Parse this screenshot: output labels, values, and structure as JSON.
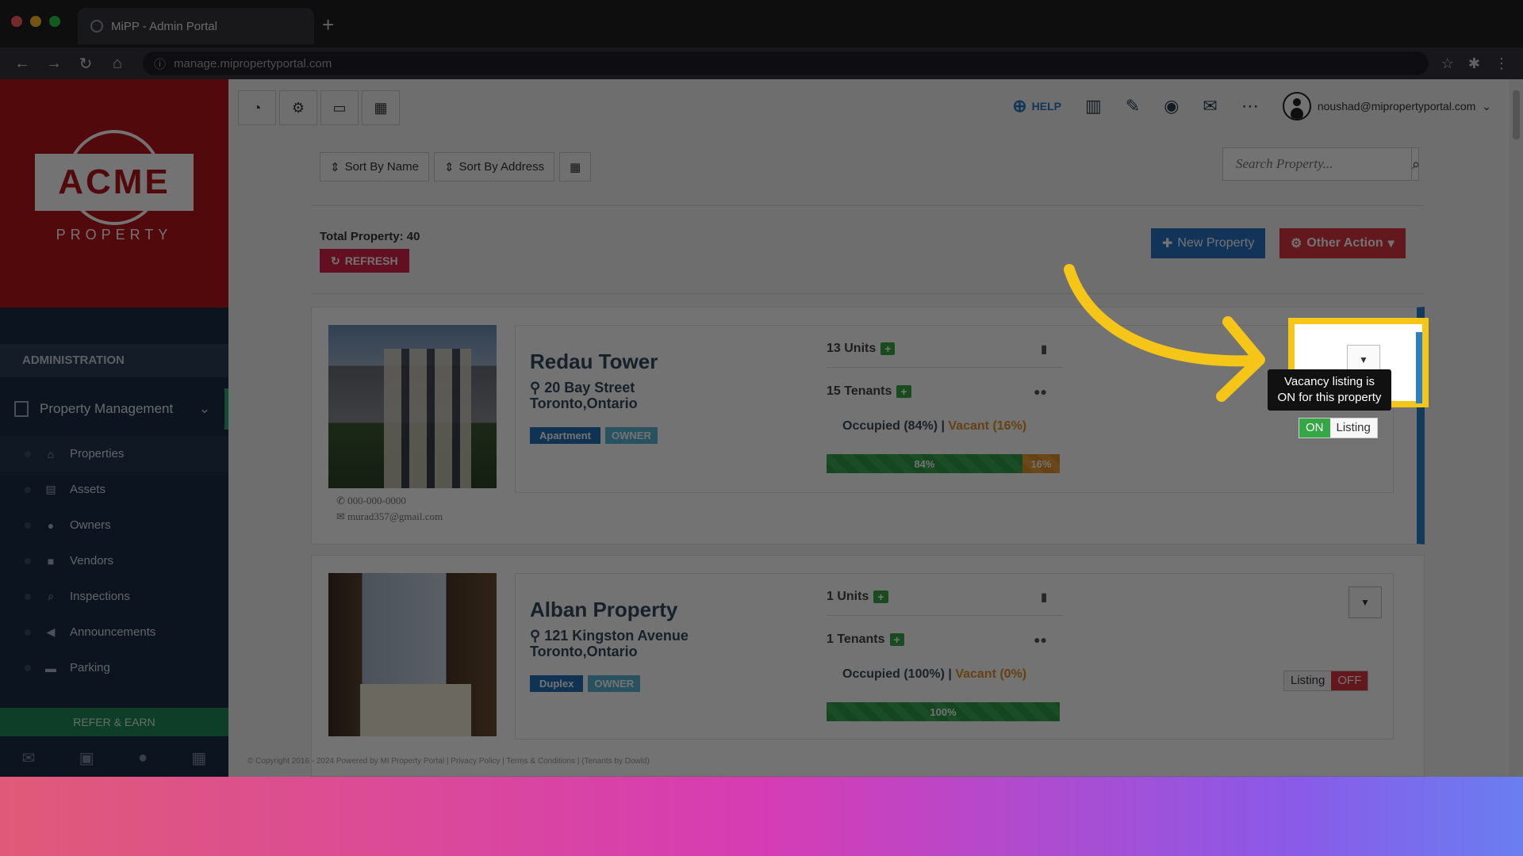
{
  "browser": {
    "tab_title": "MiPP - Admin Portal",
    "url": "manage.mipropertyportal.com"
  },
  "sidebar": {
    "logo_main": "ACME",
    "logo_sub": "PROPERTY",
    "section": "ADMINISTRATION",
    "group": "Property Management",
    "items": [
      {
        "label": "Properties",
        "icon": "home-icon"
      },
      {
        "label": "Assets",
        "icon": "archive-icon"
      },
      {
        "label": "Owners",
        "icon": "user-icon"
      },
      {
        "label": "Vendors",
        "icon": "briefcase-icon"
      },
      {
        "label": "Inspections",
        "icon": "search-icon"
      },
      {
        "label": "Announcements",
        "icon": "megaphone-icon"
      },
      {
        "label": "Parking",
        "icon": "car-icon"
      }
    ],
    "refer": "REFER & EARN"
  },
  "topbar": {
    "help": "HELP",
    "user_email": "noushad@mipropertyportal.com"
  },
  "toolbar": {
    "sort_name": "Sort By Name",
    "sort_address": "Sort By Address",
    "search_placeholder": "Search Property...",
    "total": "Total Property: 40",
    "refresh": "REFRESH",
    "new_property": "New Property",
    "other_action": "Other Action"
  },
  "properties": [
    {
      "name": "Redau Tower",
      "address1": "20 Bay Street",
      "address2": "Toronto,Ontario",
      "type": "Apartment",
      "owner": "OWNER",
      "units": "13 Units",
      "tenants": "15 Tenants",
      "occupied": "Occupied (84%)",
      "vacant": "Vacant (16%)",
      "occupied_pct": 84,
      "vacant_pct": 16,
      "occ_label": "84%",
      "vac_label": "16%",
      "phone": "000-000-0000",
      "email": "murad357@gmail.com",
      "toggle_on": "ON",
      "toggle_label": "Listing"
    },
    {
      "name": "Alban Property",
      "address1": "121 Kingston Avenue",
      "address2": "Toronto,Ontario",
      "type": "Duplex",
      "owner": "OWNER",
      "units": "1 Units",
      "tenants": "1 Tenants",
      "occupied": "Occupied (100%)",
      "vacant": "Vacant (0%)",
      "occupied_pct": 100,
      "vacant_pct": 0,
      "occ_label": "100%",
      "toggle_label": "Listing",
      "toggle_off": "OFF"
    }
  ],
  "tooltip": {
    "text": "Vacancy listing is ON for this property"
  },
  "footer": "© Copyright 2016 - 2024 Powered by MI Property Portal | Privacy Policy | Terms & Conditions | (Tenants by Dowld)",
  "colors": {
    "brand_red": "#b4161b",
    "sidebar": "#1c2f45",
    "highlight": "#f5c518",
    "primary": "#2873c4"
  }
}
